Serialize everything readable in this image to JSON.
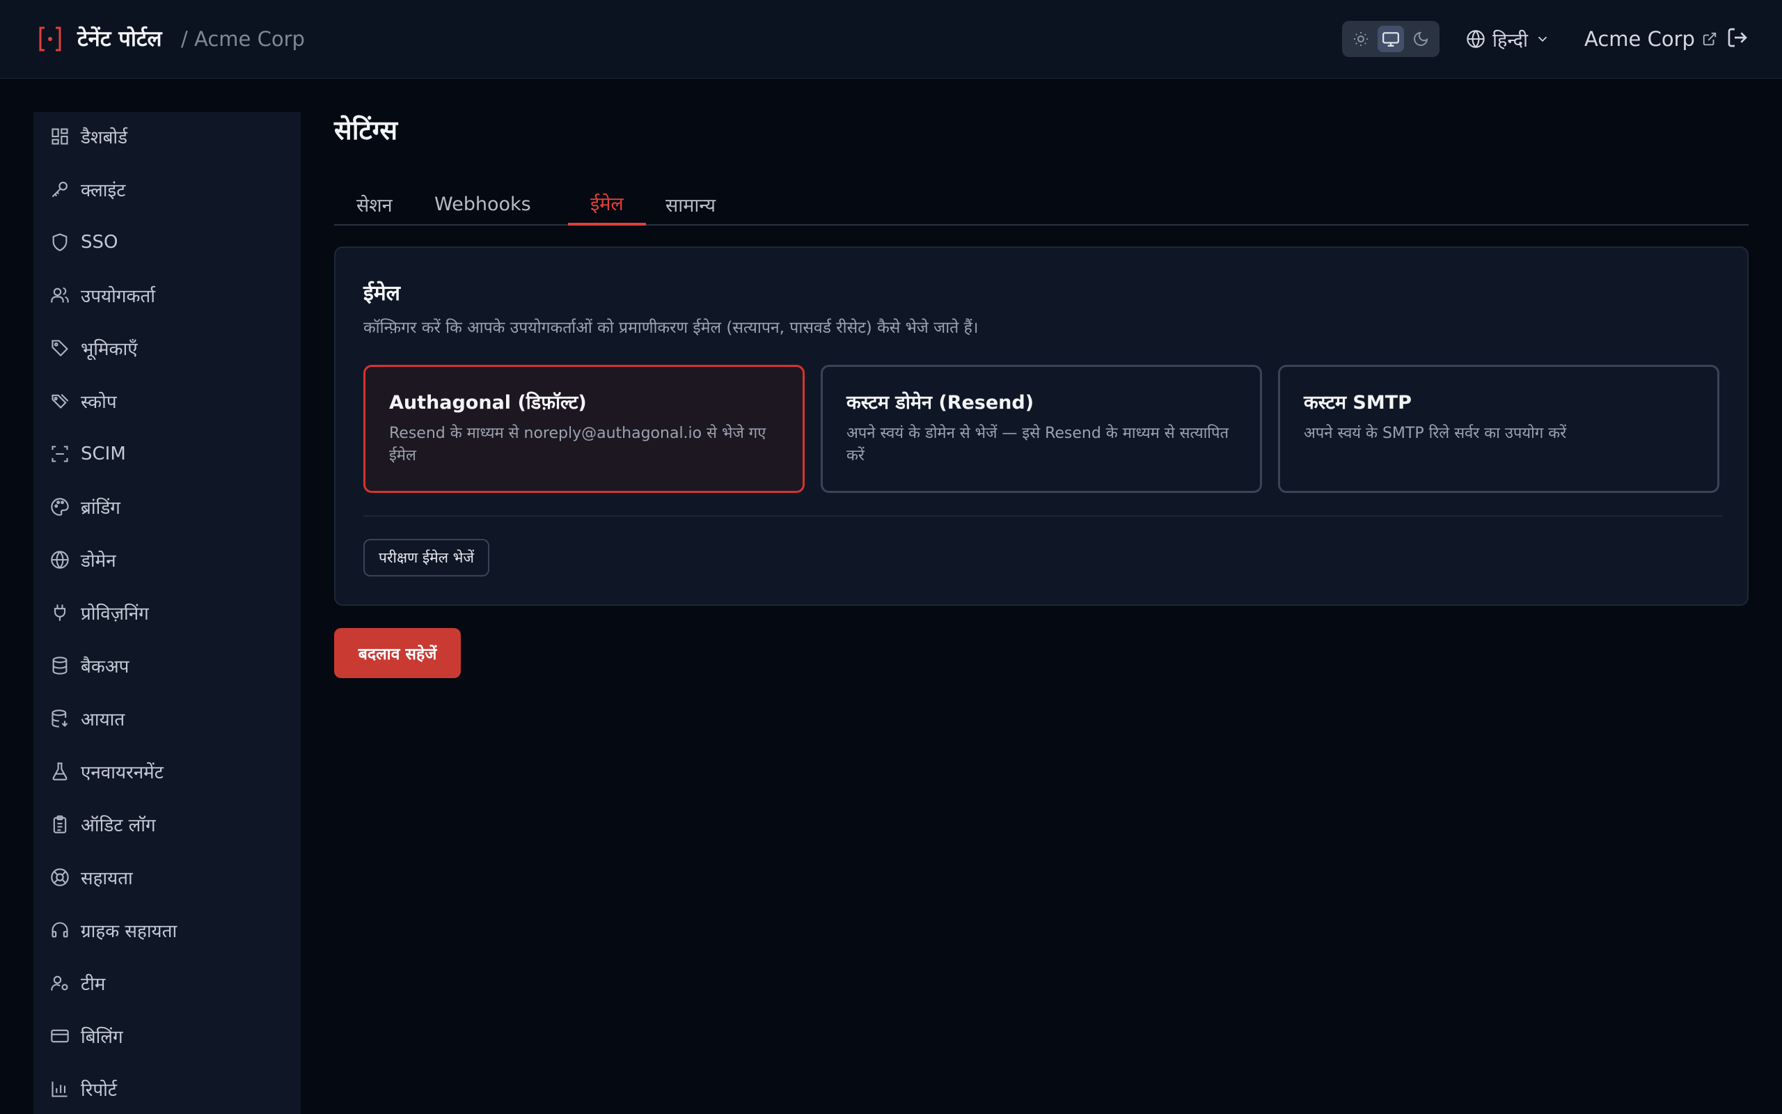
{
  "header": {
    "app_title": "टेनेंट पोर्टल",
    "tenant_crumb": "/ Acme Corp",
    "theme_options": [
      "sun-icon",
      "monitor-icon",
      "moon-icon"
    ],
    "theme_selected": "monitor-icon",
    "language": "हिन्दी",
    "tenant_link": "Acme Corp"
  },
  "sidebar": {
    "items": [
      {
        "label": "डैशबोर्ड",
        "icon": "dashboard-icon"
      },
      {
        "label": "क्लाइंट",
        "icon": "key-icon"
      },
      {
        "label": "SSO",
        "icon": "shield-icon"
      },
      {
        "label": "उपयोगकर्ता",
        "icon": "users-icon"
      },
      {
        "label": "भूमिकाएँ",
        "icon": "tag-icon"
      },
      {
        "label": "स्कोप",
        "icon": "tags-icon"
      },
      {
        "label": "SCIM",
        "icon": "scan-icon"
      },
      {
        "label": "ब्रांडिंग",
        "icon": "palette-icon"
      },
      {
        "label": "डोमेन",
        "icon": "globe-icon"
      },
      {
        "label": "प्रोविज़निंग",
        "icon": "plug-icon"
      },
      {
        "label": "बैकअप",
        "icon": "database-icon"
      },
      {
        "label": "आयात",
        "icon": "database-import-icon"
      },
      {
        "label": "एनवायरनमेंट",
        "icon": "flask-icon"
      },
      {
        "label": "ऑडिट लॉग",
        "icon": "clipboard-icon"
      },
      {
        "label": "सहायता",
        "icon": "lifebuoy-icon"
      },
      {
        "label": "ग्राहक सहायता",
        "icon": "headset-icon"
      },
      {
        "label": "टीम",
        "icon": "user-cog-icon"
      },
      {
        "label": "बिलिंग",
        "icon": "credit-card-icon"
      },
      {
        "label": "रिपोर्ट",
        "icon": "bar-chart-icon"
      }
    ]
  },
  "main": {
    "title": "सेटिंग्स",
    "tabs": [
      {
        "label": "सेशन",
        "active": false
      },
      {
        "label": "Webhooks",
        "active": false
      },
      {
        "label": "ईमेल",
        "active": true
      },
      {
        "label": "सामान्य",
        "active": false
      }
    ],
    "email_card": {
      "title": "ईमेल",
      "description": "कॉन्फ़िगर करें कि आपके उपयोगकर्ताओं को प्रमाणीकरण ईमेल (सत्यापन, पासवर्ड रीसेट) कैसे भेजे जाते हैं।",
      "options": [
        {
          "title": "Authagonal (डिफ़ॉल्ट)",
          "desc": "Resend के माध्यम से noreply@authagonal.io से भेजे गए ईमेल",
          "selected": true
        },
        {
          "title": "कस्टम डोमेन (Resend)",
          "desc": "अपने स्वयं के डोमेन से भेजें — इसे Resend के माध्यम से सत्यापित करें",
          "selected": false
        },
        {
          "title": "कस्टम SMTP",
          "desc": "अपने स्वयं के SMTP रिले सर्वर का उपयोग करें",
          "selected": false
        }
      ],
      "test_button": "परीक्षण ईमेल भेजें"
    },
    "save_button": "बदलाव सहेजें"
  },
  "colors": {
    "accent": "#e0403a",
    "primary_button": "#c93a33",
    "background": "#050912",
    "panel": "#0f1726"
  }
}
